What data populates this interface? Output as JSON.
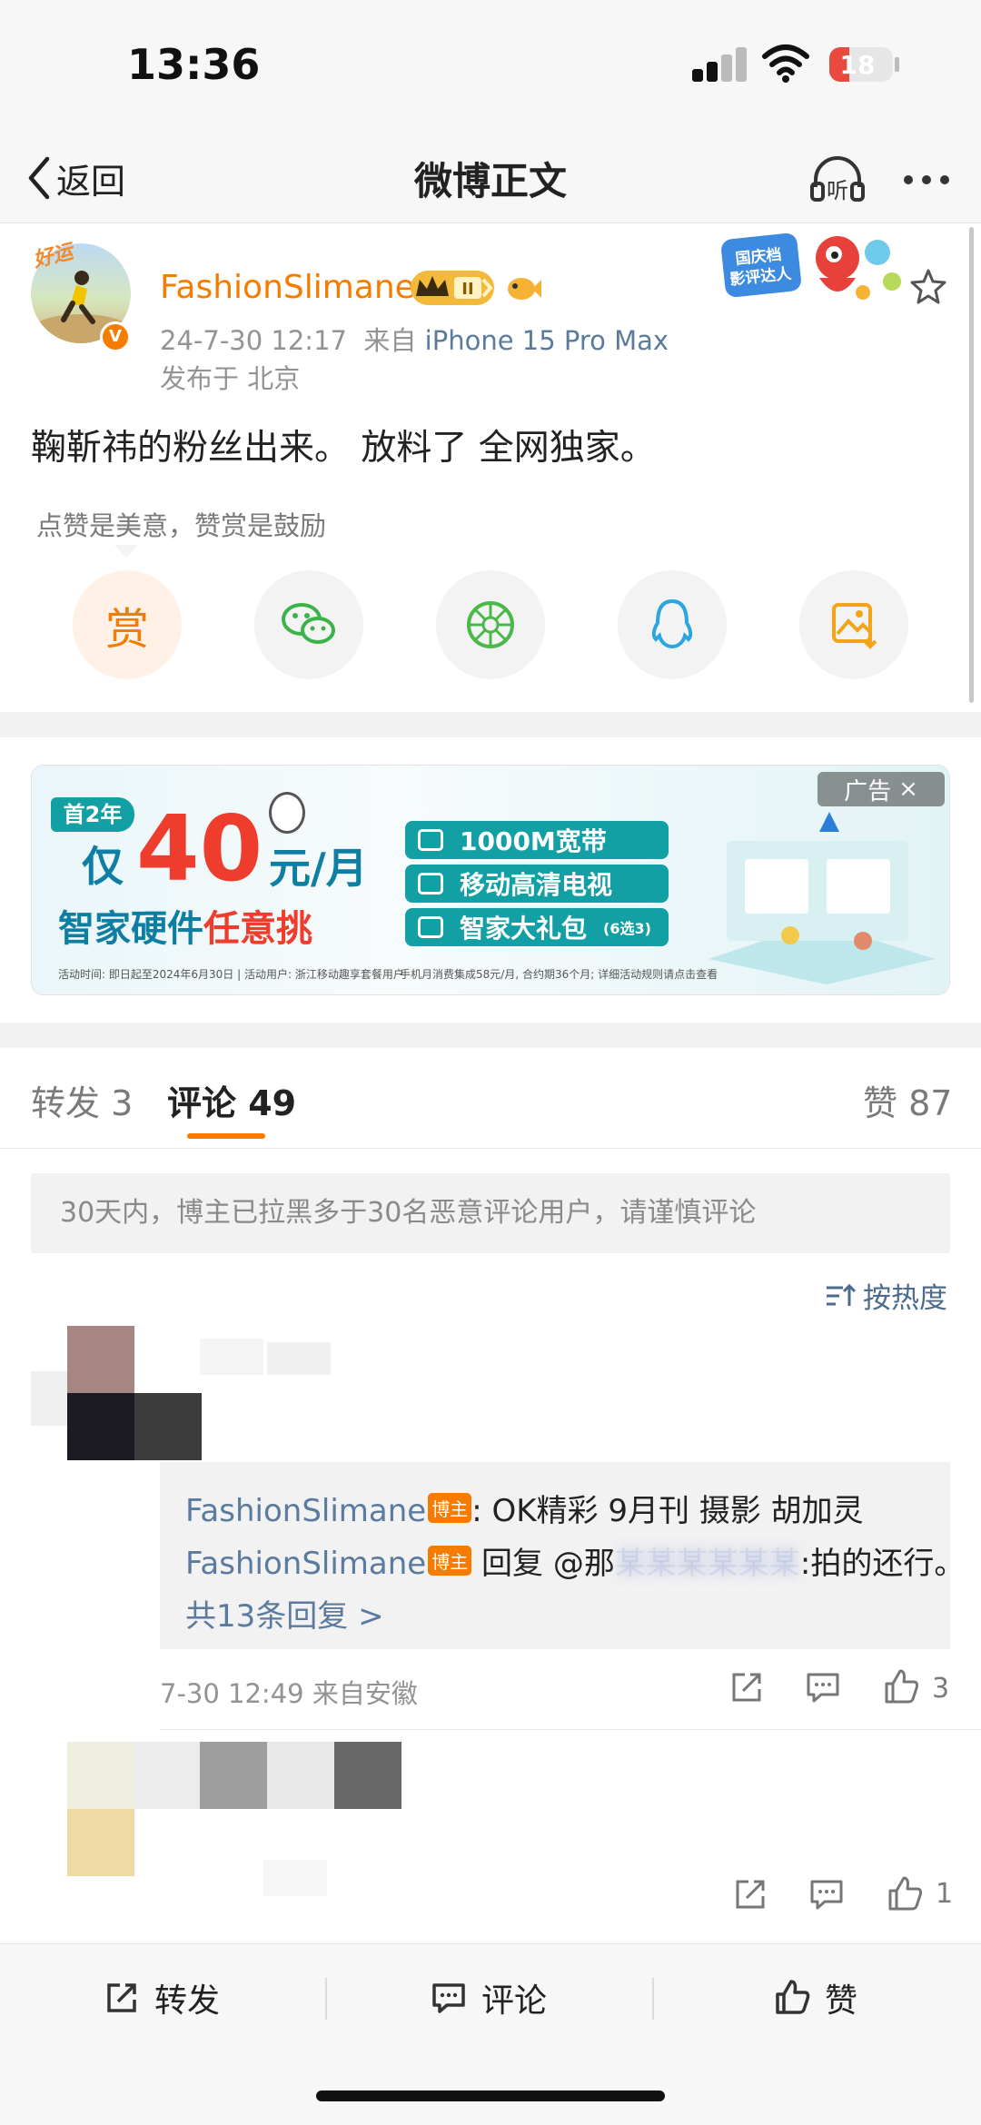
{
  "status_bar": {
    "time": "13:36",
    "battery": "18"
  },
  "nav": {
    "back_label": "返回",
    "title": "微博正文",
    "listen_label": "听"
  },
  "post": {
    "avatar_tag": "好运",
    "avatar_badge": "V",
    "username": "FashionSlimane",
    "level_badge": "II",
    "date": "24-7-30 12:17",
    "source_prefix": "来自",
    "device": "iPhone 15 Pro Max",
    "location": "发布于 北京",
    "badge_text": "国庆档\n影评达人",
    "text": "鞠靳祎的粉丝出来。 放料了 全网独家。",
    "reward_tip": "点赞是美意，赞赏是鼓励",
    "reward_label": "赏"
  },
  "ad": {
    "tag": "广告",
    "badge": "首2年",
    "only": "仅",
    "price": "40",
    "unit": "元/月",
    "line_prefix": "智家硬件",
    "line_hot": "任意挑",
    "pills": [
      {
        "label": "1000M宽带",
        "sub": ""
      },
      {
        "label": "移动高清电视",
        "sub": ""
      },
      {
        "label": "智家大礼包",
        "sub": "(6选3)"
      }
    ],
    "fine_print_1": "活动时间: 即日起至2024年6月30日 | 活动用户: 浙江移动趣享套餐用户",
    "fine_print_2": "手机月消费集成58元/月, 合约期36个月; 详细活动规则请点击查看"
  },
  "tabs": {
    "repost": "转发 3",
    "comments": "评论 49",
    "likes": "赞 87"
  },
  "notice": "30天内，博主已拉黑多于30名恶意评论用户，请谨慎评论",
  "sort_label": "按热度",
  "comments": [
    {
      "replies": [
        {
          "name": "FashionSlimane",
          "host_tag": "博主",
          "text": ": OK精彩 9月刊   摄影 胡加灵"
        },
        {
          "name": "FashionSlimane",
          "host_tag": "博主",
          "prefix": " 回复 @那",
          "blurred": "某某某某某某",
          "text": ":拍的还行。"
        }
      ],
      "more_replies": "共13条回复 >",
      "meta": "7-30 12:49 来自安徽",
      "likes": "3"
    },
    {
      "likes": "1"
    }
  ],
  "bottom_bar": {
    "repost": "转发",
    "comment": "评论",
    "like": "赞"
  },
  "colors": {
    "accent": "#f57c00",
    "link": "#5a7b9d",
    "ad_teal": "#13a0a4",
    "ad_red": "#ee3d2c"
  },
  "icons": {
    "nav": [
      "chevron-left-icon",
      "headphones-icon",
      "more-icon"
    ],
    "share": [
      "reward-icon",
      "wechat-icon",
      "moments-icon",
      "qq-icon",
      "save-image-icon"
    ],
    "comment_actions": [
      "repost-icon",
      "comment-icon",
      "like-icon"
    ]
  }
}
